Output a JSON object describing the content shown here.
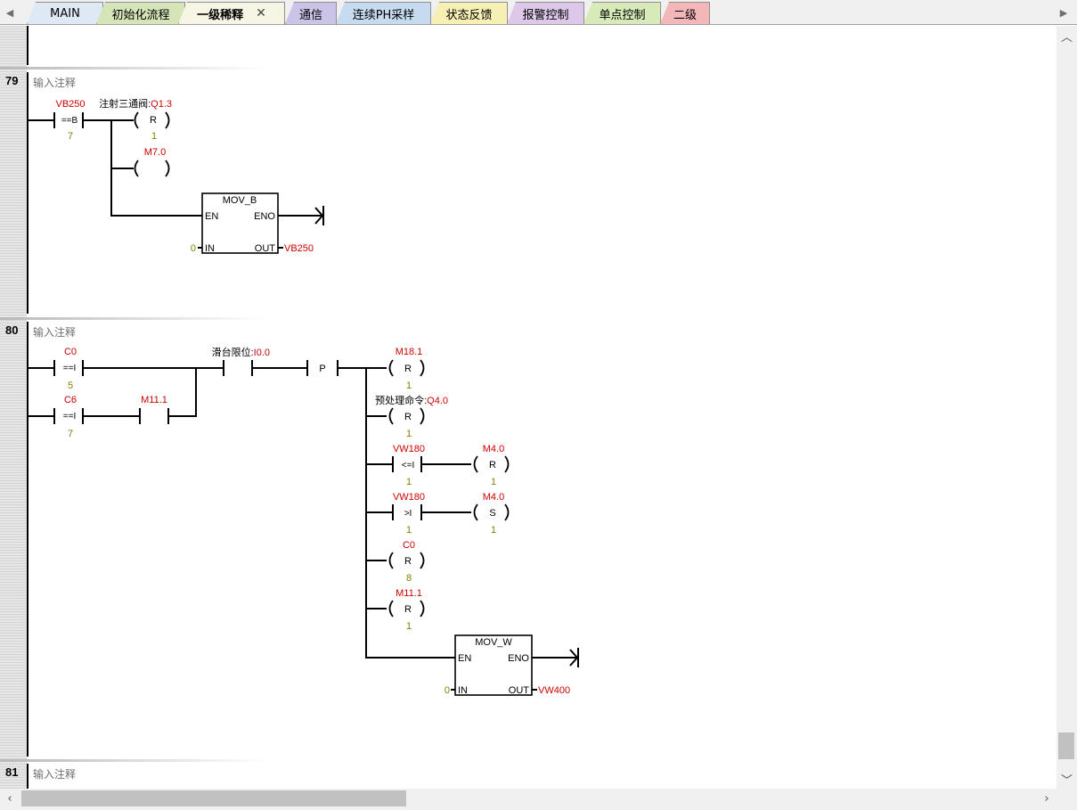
{
  "tabs": [
    {
      "label": "MAIN",
      "color": "#dfe8f5"
    },
    {
      "label": "初始化流程",
      "color": "#d5e5b7"
    },
    {
      "label": "一级稀释",
      "color": "#f7f6e4",
      "active": true
    },
    {
      "label": "通信",
      "color": "#ccc3e8"
    },
    {
      "label": "连续PH采样",
      "color": "#c6dbf0"
    },
    {
      "label": "状态反馈",
      "color": "#f7f0b4"
    },
    {
      "label": "报警控制",
      "color": "#ddc8ea"
    },
    {
      "label": "单点控制",
      "color": "#d7ebb8"
    },
    {
      "label": "二级",
      "color": "#f4b7b9"
    }
  ],
  "networks": [
    {
      "number": "79",
      "comment": "输入注释"
    },
    {
      "number": "80",
      "comment": "输入注释"
    },
    {
      "number": "81",
      "comment": "输入注释"
    }
  ],
  "colors": {
    "operand": "#cc0000",
    "param": "#808000",
    "wire": "#000000"
  },
  "n79": {
    "cmp_addr": "VB250",
    "cmp_op": "==B",
    "cmp_val": "7",
    "coil1_name": "注射三通阀:",
    "coil1_addr": "Q1.3",
    "coil1_type": "R",
    "coil1_n": "1",
    "coil2_addr": "M7.0",
    "mov_name": "MOV_B",
    "mov_en": "EN",
    "mov_eno": "ENO",
    "mov_in": "IN",
    "mov_out": "OUT",
    "mov_in_val": "0",
    "mov_out_val": "VB250"
  },
  "n80": {
    "c1_addr": "C0",
    "c1_op": "==I",
    "c1_val": "5",
    "c2_addr": "C6",
    "c2_op": "==I",
    "c2_val": "7",
    "c3_addr": "M11.1",
    "c4_name": "滑台限位:",
    "c4_addr": "I0.0",
    "pos_edge": "P",
    "o1_addr": "M18.1",
    "o1_type": "R",
    "o1_n": "1",
    "o2_name": "预处理命令:",
    "o2_addr": "Q4.0",
    "o2_type": "R",
    "o2_n": "1",
    "o3_cmp_addr": "VW180",
    "o3_cmp_op": "<=I",
    "o3_cmp_val": "1",
    "o3_coil_addr": "M4.0",
    "o3_coil_type": "R",
    "o3_coil_n": "1",
    "o4_cmp_addr": "VW180",
    "o4_cmp_op": ">I",
    "o4_cmp_val": "1",
    "o4_coil_addr": "M4.0",
    "o4_coil_type": "S",
    "o4_coil_n": "1",
    "o5_addr": "C0",
    "o5_type": "R",
    "o5_n": "8",
    "o6_addr": "M11.1",
    "o6_type": "R",
    "o6_n": "1",
    "mov_name": "MOV_W",
    "mov_en": "EN",
    "mov_eno": "ENO",
    "mov_in": "IN",
    "mov_out": "OUT",
    "mov_in_val": "0",
    "mov_out_val": "VW400"
  }
}
